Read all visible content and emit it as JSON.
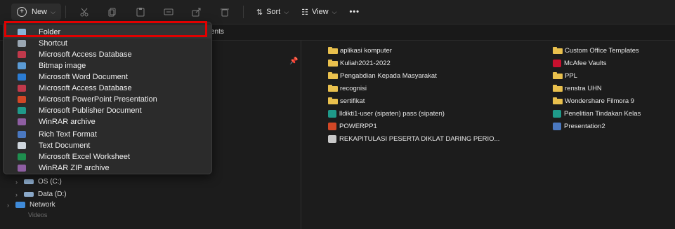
{
  "toolbar": {
    "new_label": "New",
    "sort_label": "Sort",
    "view_label": "View",
    "more_label": "•••"
  },
  "address": {
    "segment": "ents"
  },
  "nav": {
    "os_drive": "OS (C:)",
    "data_drive": "Data (D:)",
    "network": "Network",
    "clipped_text": "Videos"
  },
  "new_menu": {
    "items": [
      {
        "label": "Folder",
        "icon": "folder-icon",
        "color": "#8ab4d8"
      },
      {
        "label": "Shortcut",
        "icon": "shortcut-icon",
        "color": "#9aa6b2"
      },
      {
        "label": "Microsoft Access Database",
        "icon": "access-icon",
        "color": "#c0394b"
      },
      {
        "label": "Bitmap image",
        "icon": "bitmap-icon",
        "color": "#5b9bd5"
      },
      {
        "label": "Microsoft Word Document",
        "icon": "word-icon",
        "color": "#2b7cd3"
      },
      {
        "label": "Microsoft Access Database",
        "icon": "access-icon",
        "color": "#c0394b"
      },
      {
        "label": "Microsoft PowerPoint Presentation",
        "icon": "powerpoint-icon",
        "color": "#d24726"
      },
      {
        "label": "Microsoft Publisher Document",
        "icon": "publisher-icon",
        "color": "#1f9a8a"
      },
      {
        "label": "WinRAR archive",
        "icon": "winrar-icon",
        "color": "#8e5ea2"
      },
      {
        "label": "Rich Text Format",
        "icon": "rtf-icon",
        "color": "#4a78c0"
      },
      {
        "label": "Text Document",
        "icon": "text-icon",
        "color": "#cfd6dd"
      },
      {
        "label": "Microsoft Excel Worksheet",
        "icon": "excel-icon",
        "color": "#1e8e4e"
      },
      {
        "label": "WinRAR ZIP archive",
        "icon": "winrar-zip-icon",
        "color": "#8e5ea2"
      }
    ]
  },
  "files": {
    "col1": [
      {
        "label": "aplikasi komputer",
        "icon": "folder-icon"
      },
      {
        "label": "Kuliah2021-2022",
        "icon": "folder-icon"
      },
      {
        "label": "Pengabdian Kepada Masyarakat",
        "icon": "folder-icon"
      },
      {
        "label": "recognisi",
        "icon": "folder-icon"
      },
      {
        "label": "sertifikat",
        "icon": "folder-icon"
      },
      {
        "label": "lldikti1-user (sipaten) pass (sipaten)",
        "icon": "publisher-icon"
      },
      {
        "label": "POWERPP1",
        "icon": "powerpoint-icon"
      },
      {
        "label": "REKAPITULASI PESERTA DIKLAT DARING PERIO...",
        "icon": "pdf-icon"
      }
    ],
    "col2": [
      {
        "label": "Custom Office Templates",
        "icon": "folder-icon"
      },
      {
        "label": "McAfee Vaults",
        "icon": "mcafee-icon"
      },
      {
        "label": "PPL",
        "icon": "folder-icon"
      },
      {
        "label": "renstra UHN",
        "icon": "folder-icon"
      },
      {
        "label": "Wondershare Filmora 9",
        "icon": "folder-icon"
      },
      {
        "label": "Penelitian Tindakan Kelas",
        "icon": "publisher-icon"
      },
      {
        "label": "Presentation2",
        "icon": "presentation-icon"
      }
    ]
  }
}
